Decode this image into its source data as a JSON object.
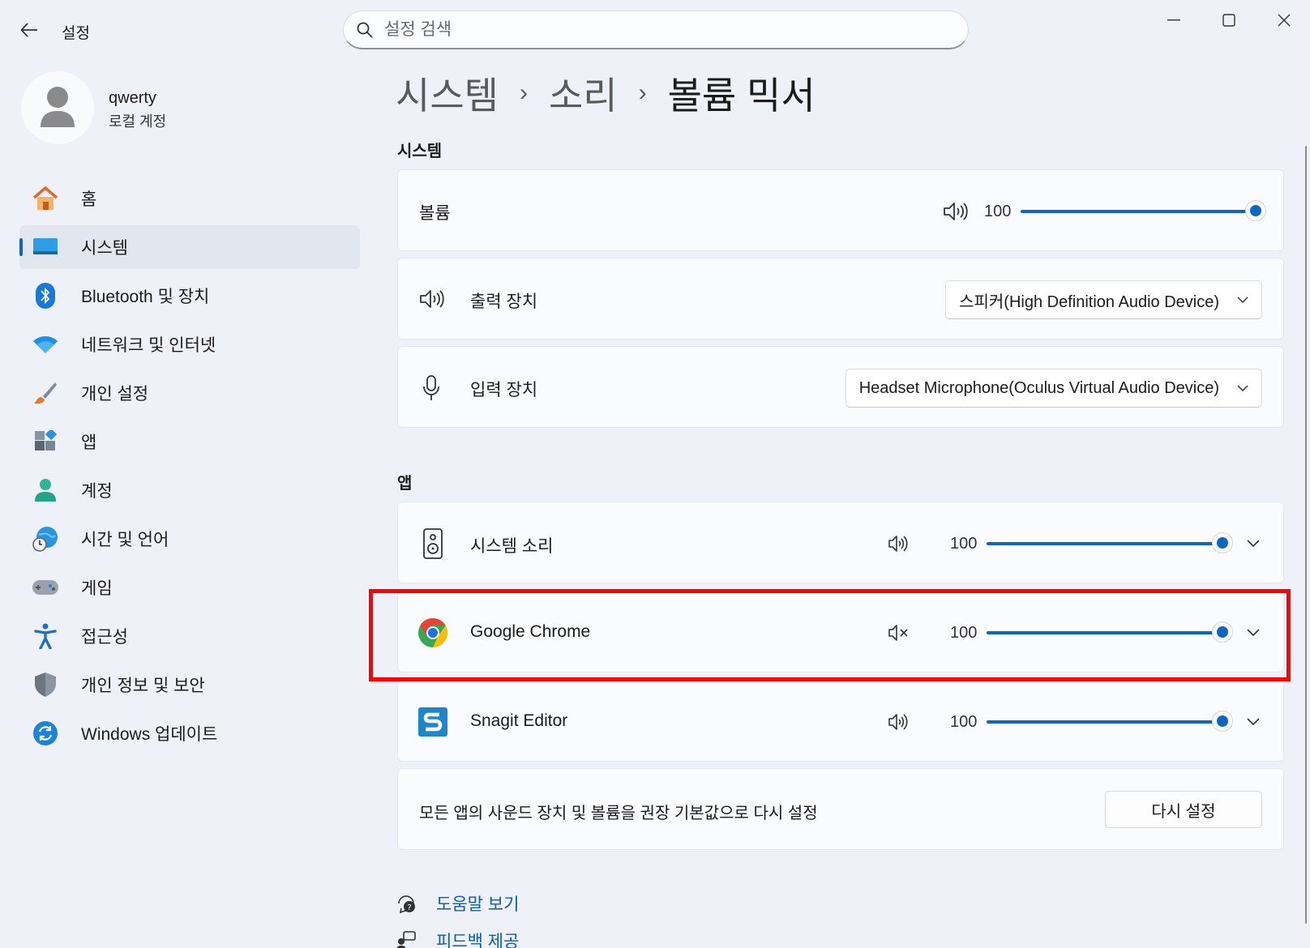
{
  "window": {
    "title": "설정",
    "controls": [
      "minimize",
      "maximize",
      "close"
    ]
  },
  "search": {
    "placeholder": "설정 검색"
  },
  "user": {
    "name": "qwerty",
    "account_type": "로컬 계정"
  },
  "sidebar": {
    "items": [
      {
        "label": "홈",
        "icon": "home-icon"
      },
      {
        "label": "시스템",
        "icon": "system-icon",
        "active": true
      },
      {
        "label": "Bluetooth 및 장치",
        "icon": "bluetooth-icon"
      },
      {
        "label": "네트워크 및 인터넷",
        "icon": "wifi-icon"
      },
      {
        "label": "개인 설정",
        "icon": "brush-icon"
      },
      {
        "label": "앱",
        "icon": "apps-icon"
      },
      {
        "label": "계정",
        "icon": "account-icon"
      },
      {
        "label": "시간 및 언어",
        "icon": "globe-clock-icon"
      },
      {
        "label": "게임",
        "icon": "gamepad-icon"
      },
      {
        "label": "접근성",
        "icon": "accessibility-icon"
      },
      {
        "label": "개인 정보 및 보안",
        "icon": "shield-icon"
      },
      {
        "label": "Windows 업데이트",
        "icon": "update-icon"
      }
    ]
  },
  "breadcrumb": {
    "items": [
      "시스템",
      "소리",
      "볼륨 믹서"
    ]
  },
  "system_section": {
    "title": "시스템",
    "volume": {
      "label": "볼륨",
      "value": "100",
      "level": 1.0
    },
    "output": {
      "label": "출력 장치",
      "selected": "스피커(High Definition Audio Device)"
    },
    "input": {
      "label": "입력 장치",
      "selected": "Headset Microphone(Oculus Virtual Audio Device)"
    }
  },
  "apps_section": {
    "title": "앱",
    "apps": [
      {
        "name": "시스템 소리",
        "value": "100",
        "level": 1.0,
        "muted": false,
        "icon": "system-sounds-icon"
      },
      {
        "name": "Google Chrome",
        "value": "100",
        "level": 1.0,
        "muted": true,
        "icon": "chrome-icon"
      },
      {
        "name": "Snagit Editor",
        "value": "100",
        "level": 1.0,
        "muted": false,
        "icon": "snagit-icon"
      }
    ],
    "reset": {
      "label": "모든 앱의 사운드 장치 및 볼륨을 권장 기본값으로 다시 설정",
      "button": "다시 설정"
    }
  },
  "links": {
    "help": "도움말 보기",
    "feedback": "피드백 제공"
  },
  "colors": {
    "accent": "#0b67c2",
    "highlight": "#ff0000",
    "background": "#eef2f8"
  }
}
